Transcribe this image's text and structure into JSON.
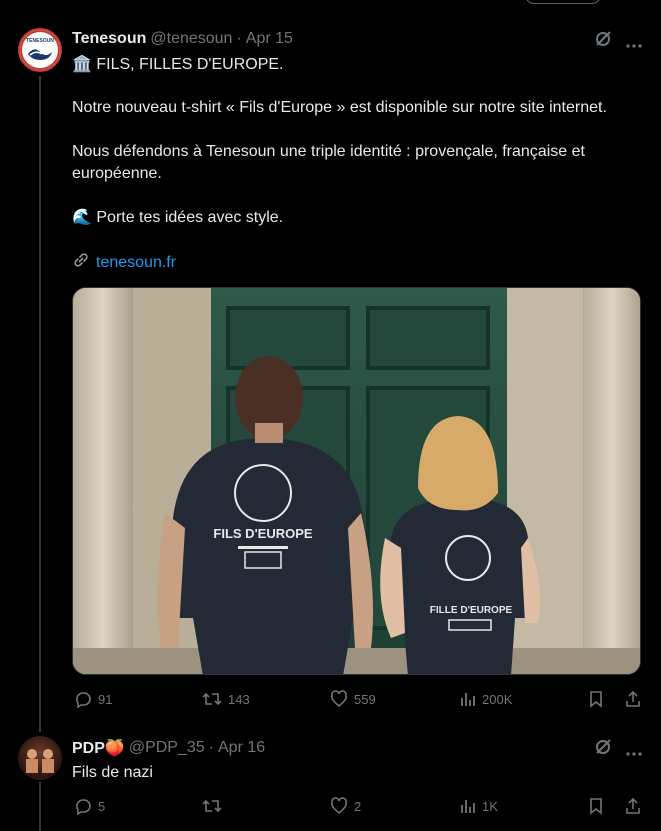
{
  "tweet": {
    "name": "Tenesoun",
    "handle": "@tenesoun",
    "date": "Apr 15",
    "lines": [
      "🏛️ FILS, FILLES D'EUROPE.",
      "Notre nouveau t-shirt « Fils d'Europe » est disponible sur notre site internet.",
      "Nous défendons à Tenesoun une triple identité : provençale, française et européenne.",
      "🌊 Porte tes idées avec style."
    ],
    "link": "tenesoun.fr",
    "avatar_text": "TENESOUN",
    "shirt_text": "FILS D'EUROPE",
    "shirt_text2": "FILLE D'EUROPE",
    "stats": {
      "replies": "91",
      "retweets": "143",
      "likes": "559",
      "views": "200K"
    }
  },
  "reply": {
    "name": "PDP🍑",
    "handle": "@PDP_35",
    "date": "Apr 16",
    "text": "Fils de nazi",
    "stats": {
      "replies": "5",
      "retweets": "",
      "likes": "2",
      "views": "1K"
    }
  },
  "separator": "·",
  "colors": {
    "accent": "#1d9bf0",
    "muted": "#71767b",
    "text": "#e7e9ea",
    "background": "#000000"
  }
}
